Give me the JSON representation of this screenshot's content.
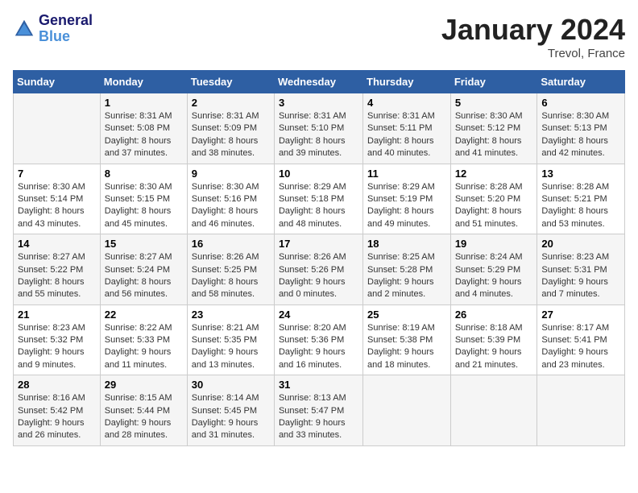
{
  "header": {
    "logo_general": "General",
    "logo_blue": "Blue",
    "month_title": "January 2024",
    "location": "Trevol, France"
  },
  "weekdays": [
    "Sunday",
    "Monday",
    "Tuesday",
    "Wednesday",
    "Thursday",
    "Friday",
    "Saturday"
  ],
  "weeks": [
    [
      {
        "day": "",
        "info": ""
      },
      {
        "day": "1",
        "info": "Sunrise: 8:31 AM\nSunset: 5:08 PM\nDaylight: 8 hours\nand 37 minutes."
      },
      {
        "day": "2",
        "info": "Sunrise: 8:31 AM\nSunset: 5:09 PM\nDaylight: 8 hours\nand 38 minutes."
      },
      {
        "day": "3",
        "info": "Sunrise: 8:31 AM\nSunset: 5:10 PM\nDaylight: 8 hours\nand 39 minutes."
      },
      {
        "day": "4",
        "info": "Sunrise: 8:31 AM\nSunset: 5:11 PM\nDaylight: 8 hours\nand 40 minutes."
      },
      {
        "day": "5",
        "info": "Sunrise: 8:30 AM\nSunset: 5:12 PM\nDaylight: 8 hours\nand 41 minutes."
      },
      {
        "day": "6",
        "info": "Sunrise: 8:30 AM\nSunset: 5:13 PM\nDaylight: 8 hours\nand 42 minutes."
      }
    ],
    [
      {
        "day": "7",
        "info": "Sunrise: 8:30 AM\nSunset: 5:14 PM\nDaylight: 8 hours\nand 43 minutes."
      },
      {
        "day": "8",
        "info": "Sunrise: 8:30 AM\nSunset: 5:15 PM\nDaylight: 8 hours\nand 45 minutes."
      },
      {
        "day": "9",
        "info": "Sunrise: 8:30 AM\nSunset: 5:16 PM\nDaylight: 8 hours\nand 46 minutes."
      },
      {
        "day": "10",
        "info": "Sunrise: 8:29 AM\nSunset: 5:18 PM\nDaylight: 8 hours\nand 48 minutes."
      },
      {
        "day": "11",
        "info": "Sunrise: 8:29 AM\nSunset: 5:19 PM\nDaylight: 8 hours\nand 49 minutes."
      },
      {
        "day": "12",
        "info": "Sunrise: 8:28 AM\nSunset: 5:20 PM\nDaylight: 8 hours\nand 51 minutes."
      },
      {
        "day": "13",
        "info": "Sunrise: 8:28 AM\nSunset: 5:21 PM\nDaylight: 8 hours\nand 53 minutes."
      }
    ],
    [
      {
        "day": "14",
        "info": "Sunrise: 8:27 AM\nSunset: 5:22 PM\nDaylight: 8 hours\nand 55 minutes."
      },
      {
        "day": "15",
        "info": "Sunrise: 8:27 AM\nSunset: 5:24 PM\nDaylight: 8 hours\nand 56 minutes."
      },
      {
        "day": "16",
        "info": "Sunrise: 8:26 AM\nSunset: 5:25 PM\nDaylight: 8 hours\nand 58 minutes."
      },
      {
        "day": "17",
        "info": "Sunrise: 8:26 AM\nSunset: 5:26 PM\nDaylight: 9 hours\nand 0 minutes."
      },
      {
        "day": "18",
        "info": "Sunrise: 8:25 AM\nSunset: 5:28 PM\nDaylight: 9 hours\nand 2 minutes."
      },
      {
        "day": "19",
        "info": "Sunrise: 8:24 AM\nSunset: 5:29 PM\nDaylight: 9 hours\nand 4 minutes."
      },
      {
        "day": "20",
        "info": "Sunrise: 8:23 AM\nSunset: 5:31 PM\nDaylight: 9 hours\nand 7 minutes."
      }
    ],
    [
      {
        "day": "21",
        "info": "Sunrise: 8:23 AM\nSunset: 5:32 PM\nDaylight: 9 hours\nand 9 minutes."
      },
      {
        "day": "22",
        "info": "Sunrise: 8:22 AM\nSunset: 5:33 PM\nDaylight: 9 hours\nand 11 minutes."
      },
      {
        "day": "23",
        "info": "Sunrise: 8:21 AM\nSunset: 5:35 PM\nDaylight: 9 hours\nand 13 minutes."
      },
      {
        "day": "24",
        "info": "Sunrise: 8:20 AM\nSunset: 5:36 PM\nDaylight: 9 hours\nand 16 minutes."
      },
      {
        "day": "25",
        "info": "Sunrise: 8:19 AM\nSunset: 5:38 PM\nDaylight: 9 hours\nand 18 minutes."
      },
      {
        "day": "26",
        "info": "Sunrise: 8:18 AM\nSunset: 5:39 PM\nDaylight: 9 hours\nand 21 minutes."
      },
      {
        "day": "27",
        "info": "Sunrise: 8:17 AM\nSunset: 5:41 PM\nDaylight: 9 hours\nand 23 minutes."
      }
    ],
    [
      {
        "day": "28",
        "info": "Sunrise: 8:16 AM\nSunset: 5:42 PM\nDaylight: 9 hours\nand 26 minutes."
      },
      {
        "day": "29",
        "info": "Sunrise: 8:15 AM\nSunset: 5:44 PM\nDaylight: 9 hours\nand 28 minutes."
      },
      {
        "day": "30",
        "info": "Sunrise: 8:14 AM\nSunset: 5:45 PM\nDaylight: 9 hours\nand 31 minutes."
      },
      {
        "day": "31",
        "info": "Sunrise: 8:13 AM\nSunset: 5:47 PM\nDaylight: 9 hours\nand 33 minutes."
      },
      {
        "day": "",
        "info": ""
      },
      {
        "day": "",
        "info": ""
      },
      {
        "day": "",
        "info": ""
      }
    ]
  ]
}
